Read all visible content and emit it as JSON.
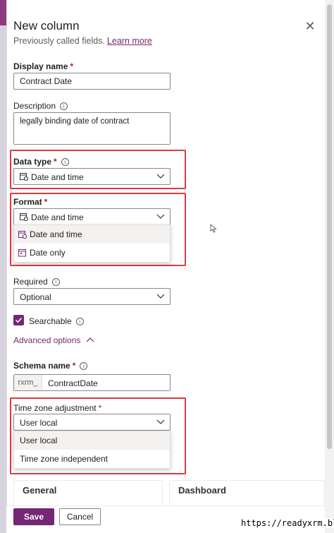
{
  "panel": {
    "title": "New column",
    "subtitle": "Previously called fields.",
    "learn_more": "Learn more",
    "close_glyph": "✕"
  },
  "fields": {
    "display_name": {
      "label": "Display name",
      "required": "*",
      "value": "Contract Date"
    },
    "description": {
      "label": "Description",
      "value": "legally binding date of contract"
    },
    "data_type": {
      "label": "Data type",
      "required": "*",
      "value": "Date and time",
      "icon": "calendar-clock-icon"
    },
    "format": {
      "label": "Format",
      "required": "*",
      "value": "Date and time",
      "icon": "calendar-clock-icon",
      "options": [
        {
          "label": "Date and time",
          "icon": "calendar-clock-icon",
          "selected": true
        },
        {
          "label": "Date only",
          "icon": "calendar-icon",
          "selected": false
        }
      ]
    },
    "required": {
      "label": "Required",
      "value": "Optional"
    },
    "searchable": {
      "label": "Searchable",
      "checked": true
    },
    "advanced": {
      "label": "Advanced options"
    },
    "schema_name": {
      "label": "Schema name",
      "required": "*",
      "prefix": "rxrm_",
      "value": "ContractDate"
    },
    "time_zone": {
      "label": "Time zone adjustment",
      "required": "*",
      "value": "User local",
      "options": [
        {
          "label": "User local",
          "selected": true
        },
        {
          "label": "Time zone independent",
          "selected": false
        }
      ]
    }
  },
  "background_cards": [
    "General",
    "Dashboard"
  ],
  "footer": {
    "save_label": "Save",
    "cancel_label": "Cancel"
  },
  "watermark": "https://readyxrm.blog",
  "colors": {
    "accent": "#742774",
    "highlight_box": "#e0393e",
    "link": "#7a2a6e"
  }
}
